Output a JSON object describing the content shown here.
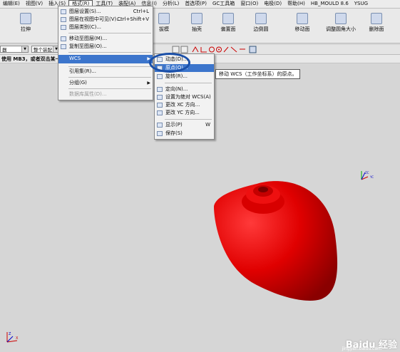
{
  "menubar": {
    "items": [
      "编辑(E)",
      "视图(V)",
      "插入(S)",
      "格式(R)",
      "工具(T)",
      "装配(A)",
      "信息(I)",
      "分析(L)",
      "首选项(P)",
      "GC工具箱",
      "窗口(O)",
      "电极(D)",
      "帮助(H)",
      "HB_MOULD 8.6",
      "YSUG"
    ],
    "active_index": 3
  },
  "toolbar": {
    "tools": [
      "拉伸",
      "拔模",
      "抽壳",
      "偏置面",
      "边倒圆",
      "移动面",
      "调整圆角大小",
      "删除面"
    ]
  },
  "selection_bar": {
    "filter_value": "器",
    "scope_value": "整个装配"
  },
  "status": {
    "text": "使用 MB3，或者双击某一对"
  },
  "format_menu": {
    "items": [
      {
        "label": "图层设置(S)...",
        "shortcut": "Ctrl+L",
        "icon": "layer-settings-icon"
      },
      {
        "label": "图层在视图中可见(V)...",
        "shortcut": "Ctrl+Shift+V",
        "icon": "layer-visible-icon"
      },
      {
        "label": "图层类别(C)...",
        "shortcut": "",
        "icon": "layer-category-icon"
      },
      {
        "label": "移动至图层(M)...",
        "shortcut": "",
        "icon": "move-to-layer-icon"
      },
      {
        "label": "复制至图层(O)...",
        "shortcut": "",
        "icon": "copy-to-layer-icon"
      },
      {
        "label": "WCS",
        "shortcut": "",
        "icon": ""
      },
      {
        "label": "引用集(R)...",
        "shortcut": "",
        "icon": ""
      },
      {
        "label": "分组(G)",
        "shortcut": "",
        "icon": ""
      },
      {
        "label": "数据库属性(D)...",
        "shortcut": "",
        "icon": ""
      }
    ]
  },
  "wcs_menu": {
    "items": [
      {
        "label": "动态(D)...",
        "shortcut": "",
        "icon": "dynamic-wcs-icon"
      },
      {
        "label": "原点(O)...",
        "shortcut": "",
        "icon": "origin-icon"
      },
      {
        "label": "旋转(R)...",
        "shortcut": "",
        "icon": "rotate-icon"
      },
      {
        "label": "定向(N)...",
        "shortcut": "",
        "icon": "orient-icon"
      },
      {
        "label": "设置为绝对 WCS(A)",
        "shortcut": "",
        "icon": "absolute-wcs-icon"
      },
      {
        "label": "更改 XC 方向...",
        "shortcut": "",
        "icon": "change-xc-icon"
      },
      {
        "label": "更改 YC 方向...",
        "shortcut": "",
        "icon": "change-yc-icon"
      },
      {
        "label": "显示(P)",
        "shortcut": "W",
        "icon": "display-icon"
      },
      {
        "label": "保存(S)",
        "shortcut": "",
        "icon": "save-icon"
      }
    ]
  },
  "tooltip": {
    "text": "移动 WCS（工作坐标系）的原点。"
  },
  "viewport": {
    "part_color": "#e00000",
    "background_color": "#d6d6d6",
    "highlight_color": "#1a4fa8",
    "triad_labels": [
      "ZC",
      "YC"
    ],
    "corner_triad_labels": [
      "Z",
      "X"
    ]
  },
  "watermark": {
    "text": "Baidu 经验",
    "sub": "jingyan.baidu.com"
  }
}
